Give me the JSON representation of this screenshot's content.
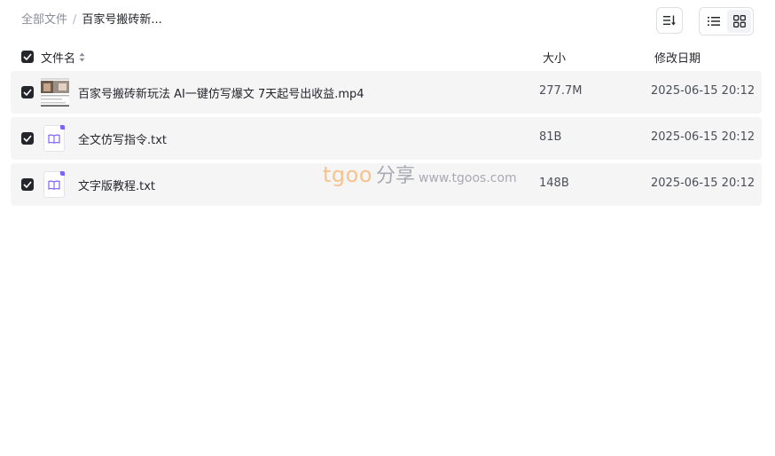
{
  "breadcrumb": {
    "root": "全部文件",
    "separator": "/",
    "current": "百家号搬砖新..."
  },
  "toolbar": {
    "sort_icon": "sort-descending-icon",
    "view_modes": [
      {
        "icon": "list-view-icon",
        "active": false
      },
      {
        "icon": "grid-view-icon",
        "active": true
      }
    ]
  },
  "columns": {
    "name": "文件名",
    "size": "大小",
    "date": "修改日期"
  },
  "files": [
    {
      "name": "百家号搬砖新玩法 AI一键仿写爆文 7天起号出收益.mp4",
      "size": "277.7M",
      "date": "2025-06-15 20:12",
      "type": "video",
      "checked": true
    },
    {
      "name": "全文仿写指令.txt",
      "size": "81B",
      "date": "2025-06-15 20:12",
      "type": "text",
      "checked": true
    },
    {
      "name": "文字版教程.txt",
      "size": "148B",
      "date": "2025-06-15 20:12",
      "type": "text",
      "checked": true
    }
  ],
  "watermark": {
    "brand": "tgoo",
    "cn": "分享",
    "url": "www.tgoos.com"
  },
  "colors": {
    "row_bg": "#f5f5f6",
    "checkbox": "#25262b",
    "text_icon_accent": "#7b61ff"
  }
}
